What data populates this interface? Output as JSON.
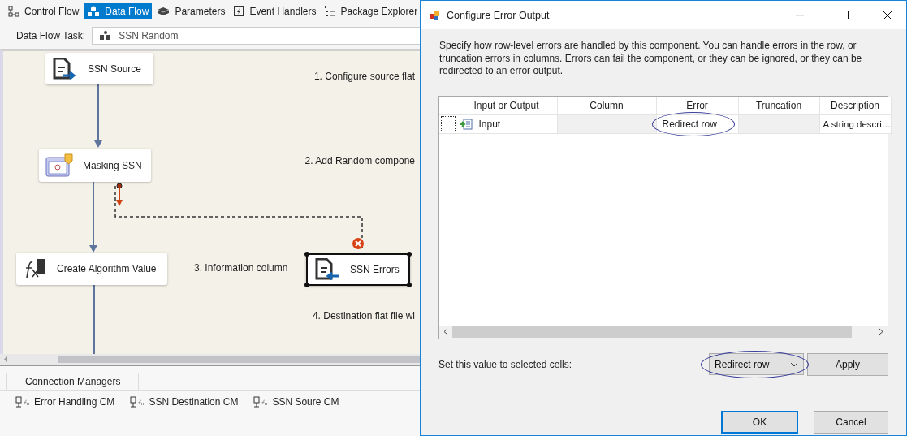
{
  "designer": {
    "tabs": [
      {
        "label": "Control Flow",
        "selected": false
      },
      {
        "label": "Data Flow",
        "selected": true
      },
      {
        "label": "Parameters",
        "selected": false
      },
      {
        "label": "Event Handlers",
        "selected": false
      },
      {
        "label": "Package Explorer",
        "selected": false
      }
    ],
    "task_label": "Data Flow Task:",
    "task_value": "SSN Random",
    "nodes": [
      {
        "label": "SSN Source",
        "kind": "source",
        "selected": false
      },
      {
        "label": "Masking SSN",
        "kind": "script",
        "selected": false
      },
      {
        "label": "Create Algorithm Value",
        "kind": "derived",
        "selected": false
      },
      {
        "label": "SSN Errors",
        "kind": "destination",
        "selected": true
      }
    ],
    "annotations": [
      "1. Configure source flat",
      "2. Add Random compone",
      "3. Information column",
      "4. Destination flat file wi"
    ],
    "connection_managers": {
      "tab": "Connection Managers",
      "items": [
        "Error Handling CM",
        "SSN Destination CM",
        "SSN Soure CM"
      ]
    }
  },
  "dialog": {
    "title": "Configure Error Output",
    "description": "Specify how row-level errors are handled by this component. You can handle errors in the row, or truncation errors in columns. Errors can fail the component, or they can be ignored, or they can be redirected to an error output.",
    "grid": {
      "columns": [
        "Input or Output",
        "Column",
        "Error",
        "Truncation",
        "Description"
      ],
      "rows": [
        {
          "input_or_output": "Input",
          "error": "Redirect row",
          "error_circled": true,
          "description": "A string descri…"
        }
      ]
    },
    "set_label": "Set this value to selected cells:",
    "value": "Redirect row",
    "value_circled": true,
    "buttons": {
      "apply": "Apply",
      "ok": "OK",
      "cancel": "Cancel"
    }
  }
}
